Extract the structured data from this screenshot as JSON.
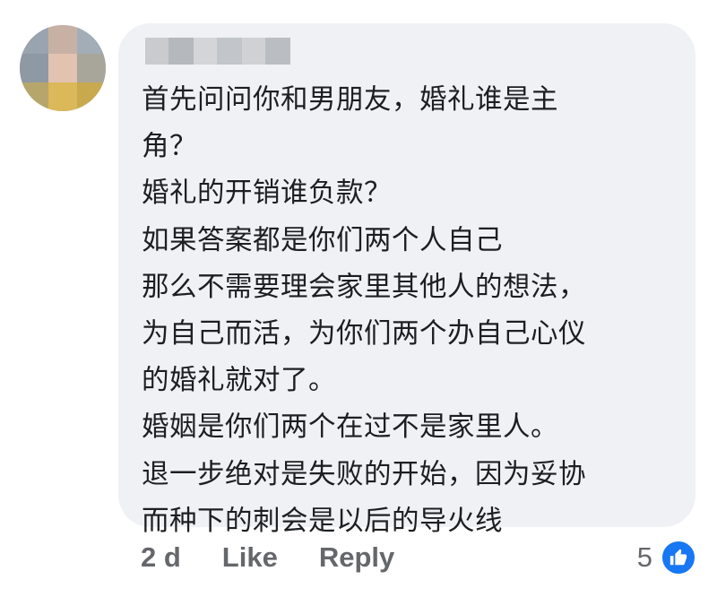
{
  "comment": {
    "text": "首先问问你和男朋友，婚礼谁是主\n角？\n婚礼的开销谁负款？\n如果答案都是你们两个人自己\n那么不需要理会家里其他人的想法，\n为自己而活，为你们两个办自己心仪\n的婚礼就对了。\n婚姻是你们两个在过不是家里人。\n退一步绝对是失败的开始，因为妥协\n而种下的刺会是以后的导火线",
    "avatar_icon": "blurred-avatar",
    "author_name_icon": "blurred-name"
  },
  "actions": {
    "time": "2 d",
    "like_label": "Like",
    "reply_label": "Reply"
  },
  "reactions": {
    "count": "5",
    "icon": "thumbs-up-icon",
    "color": "#1877f2"
  }
}
